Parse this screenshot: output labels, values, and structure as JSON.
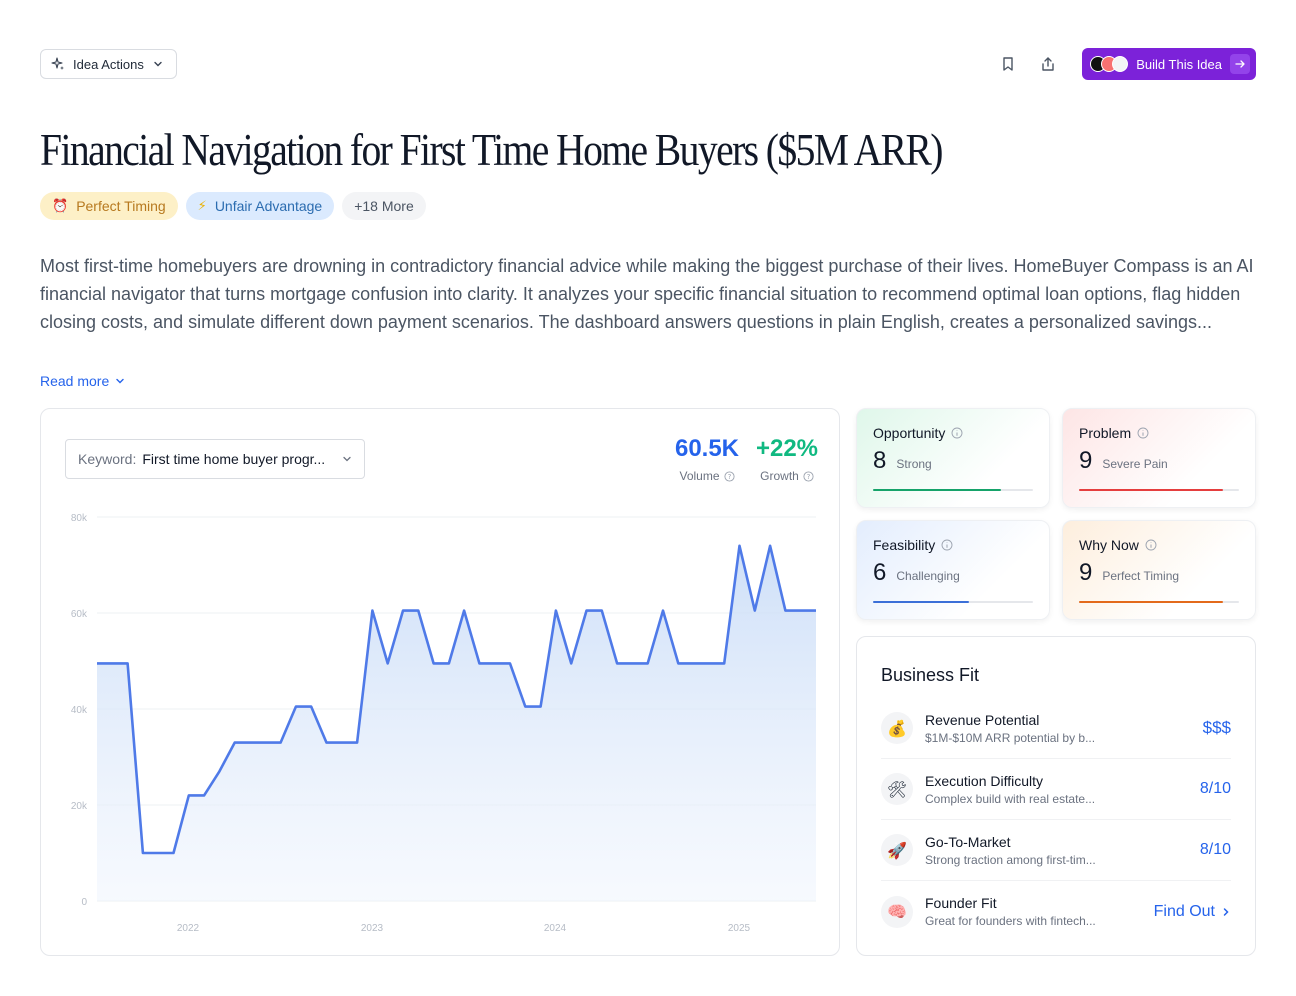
{
  "toolbar": {
    "idea_actions_label": "Idea Actions",
    "build_label": "Build This Idea"
  },
  "title": "Financial Navigation for First Time Home Buyers ($5M ARR)",
  "chips": [
    {
      "icon": "⏰",
      "label": "Perfect Timing"
    },
    {
      "icon": "⚡",
      "label": "Unfair Advantage"
    },
    {
      "label": "+18 More"
    }
  ],
  "description": "Most first-time homebuyers are drowning in contradictory financial advice while making the biggest purchase of their lives. HomeBuyer Compass is an AI financial navigator that turns mortgage confusion into clarity. It analyzes your specific financial situation to recommend optimal loan options, flag hidden closing costs, and simulate different down payment scenarios. The dashboard answers questions in plain English, creates a personalized savings...",
  "read_more": "Read more",
  "keyword": {
    "label": "Keyword:",
    "value": "First time home buyer progr..."
  },
  "stats": {
    "volume": {
      "value": "60.5K",
      "label": "Volume"
    },
    "growth": {
      "value": "+22%",
      "label": "Growth"
    }
  },
  "colors": {
    "volume": "#2563eb",
    "growth": "#10b981",
    "line": "#4f7ae8",
    "build": "#7c22d9"
  },
  "chart_data": {
    "type": "area",
    "title": "",
    "xlabel": "",
    "ylabel": "",
    "ylim": [
      0,
      80000
    ],
    "yticks": [
      "0",
      "20k",
      "40k",
      "60k",
      "80k"
    ],
    "xticks": [
      "2022",
      "2023",
      "2024",
      "2025"
    ],
    "grid": true,
    "series": [
      {
        "values": [
          49500,
          49500,
          49500,
          10000,
          10000,
          10000,
          22000,
          22000,
          27000,
          33000,
          33000,
          33000,
          33000,
          40500,
          40500,
          33000,
          33000,
          33000,
          60500,
          49500,
          60500,
          60500,
          49500,
          49500,
          60500,
          49500,
          49500,
          49500,
          40500,
          40500,
          60500,
          49500,
          60500,
          60500,
          49500,
          49500,
          49500,
          60500,
          49500,
          49500,
          49500,
          49500,
          74000,
          60500,
          74000,
          60500,
          60500,
          60500
        ]
      }
    ]
  },
  "scores": [
    {
      "title": "Opportunity",
      "value": "8",
      "desc": "Strong",
      "fraction": 0.8,
      "color": "#16a36a"
    },
    {
      "title": "Problem",
      "value": "9",
      "desc": "Severe Pain",
      "fraction": 0.9,
      "color": "#e53e3e"
    },
    {
      "title": "Feasibility",
      "value": "6",
      "desc": "Challenging",
      "fraction": 0.6,
      "color": "#3b6fd8"
    },
    {
      "title": "Why Now",
      "value": "9",
      "desc": "Perfect Timing",
      "fraction": 0.9,
      "color": "#e36a1b"
    }
  ],
  "business_fit": {
    "title": "Business Fit",
    "rows": [
      {
        "icon": "💰",
        "name": "Revenue Potential",
        "sub": "$1M-$10M ARR potential by b...",
        "value": "$$$"
      },
      {
        "icon": "🛠",
        "name": "Execution Difficulty",
        "sub": "Complex build with real estate...",
        "value": "8/10"
      },
      {
        "icon": "🚀",
        "name": "Go-To-Market",
        "sub": "Strong traction among first-tim...",
        "value": "8/10"
      },
      {
        "icon": "🧠",
        "name": "Founder Fit",
        "sub": "Great for founders with fintech...",
        "value": "Find Out"
      }
    ]
  }
}
